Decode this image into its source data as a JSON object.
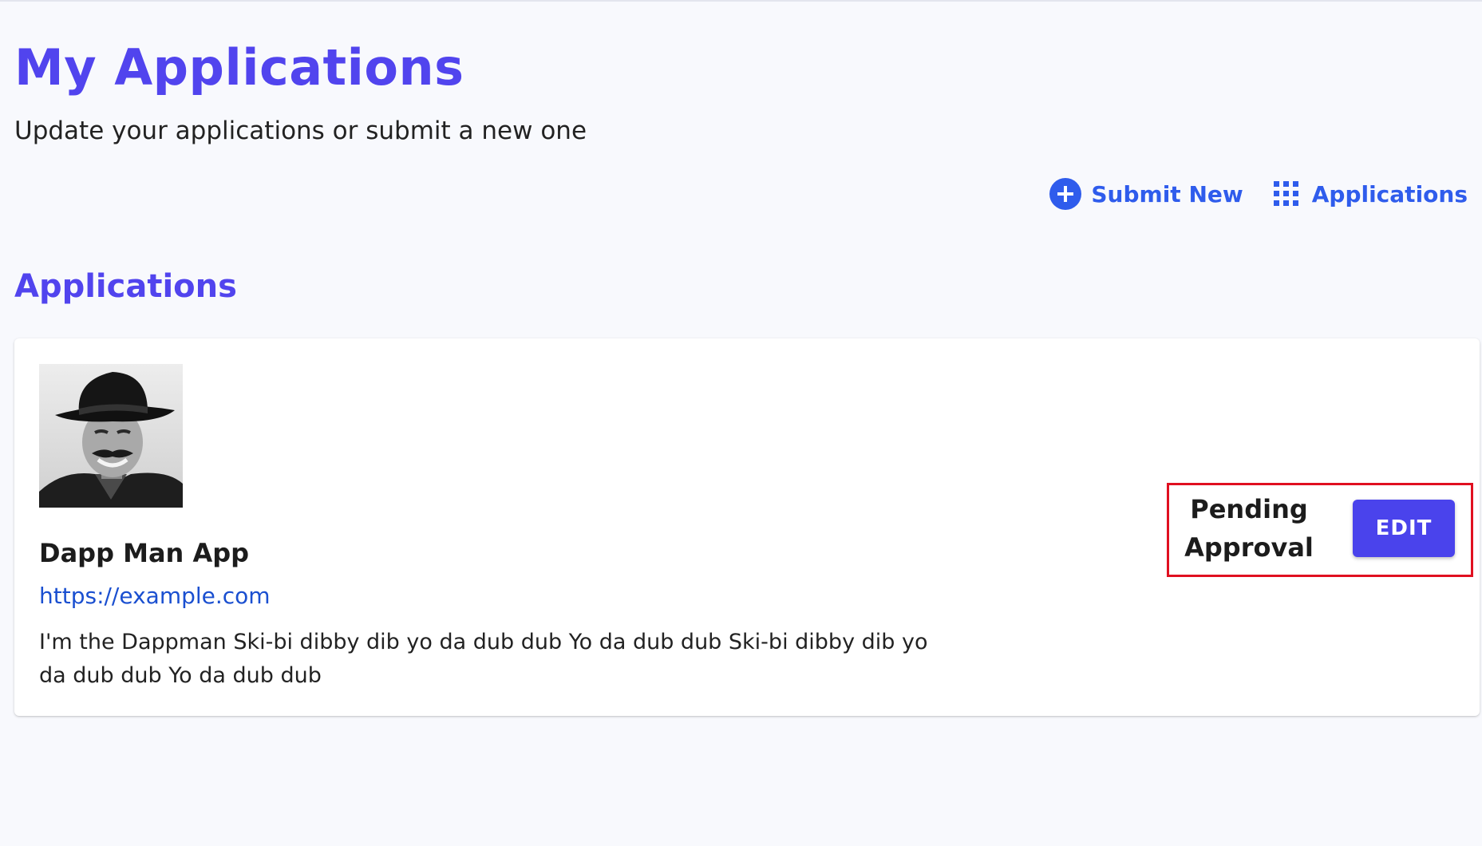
{
  "header": {
    "title": "My Applications",
    "subtitle": "Update your applications or submit a new one"
  },
  "actions": {
    "submit_new": {
      "label": "Submit New",
      "icon": "plus-circle-icon"
    },
    "applications": {
      "label": "Applications",
      "icon": "grid-icon"
    }
  },
  "section": {
    "title": "Applications"
  },
  "applications": [
    {
      "avatar": "profile-photo-man-in-hat",
      "name": "Dapp Man App",
      "url": "https://example.com",
      "description": "I'm the Dappman Ski-bi dibby dib yo da dub dub Yo da dub dub Ski-bi dibby dib yo da dub dub Yo da dub dub",
      "status": "Pending Approval",
      "edit_label": "EDIT"
    }
  ],
  "colors": {
    "accent": "#5144ee",
    "link": "#2f5cec",
    "url": "#1a4fd0",
    "button": "#4a43ec",
    "highlight_border": "#e01020",
    "background": "#f8f9fd"
  }
}
